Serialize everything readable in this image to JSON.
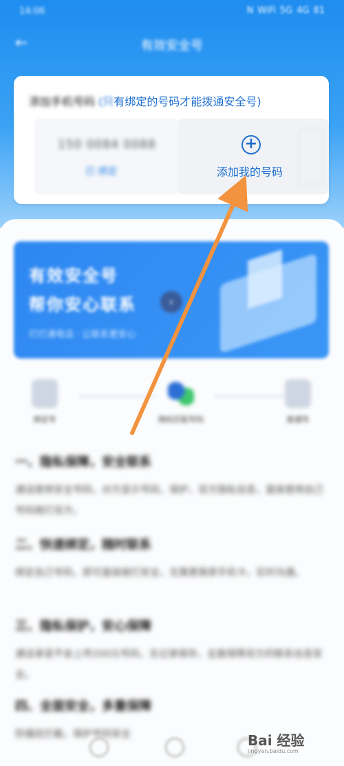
{
  "status_bar": {
    "time": "14:06",
    "icons": [
      "N",
      "WiFi",
      "5G",
      "4G",
      "81"
    ]
  },
  "titlebar": {
    "back_icon": "←",
    "title": "有效安全号"
  },
  "bind_card": {
    "hint_blurred": "添加手机号码",
    "hint_blue_partial": "(只",
    "hint_blue_clear": "有绑定的号码才能拨通安全号)",
    "existing_number": "150 0084 0088",
    "existing_sub": "已 绑定",
    "add_button_icon": "+",
    "add_button_label": "添加我的号码"
  },
  "banner": {
    "line1": "有效安全号",
    "line2": "帮你安心联系",
    "line3": "打打通电话 · 让联系更安心",
    "arrow": "›"
  },
  "steps": [
    {
      "label": "绑定号"
    },
    {
      "label": "随机匹配号码"
    },
    {
      "label": "拨通号"
    }
  ],
  "sections": [
    {
      "heading": "一、隐私保障，安全联系",
      "body": "通话使用安全号码，对方显示号码，保护，双方隐私信息，直接使用自己号码拨打双方。"
    },
    {
      "heading": "二、快速绑定，随时联系",
      "body": "绑定自己号码，即可直接拨打安全，无需更换原手机卡，实时沟通。"
    },
    {
      "heading": "三、隐私保护，安心保障",
      "body": "通话录音不会上传200元号码，无记录保存，全面保障双方的联系信息安全。"
    },
    {
      "heading": "四、全面安全，多重保障",
      "body": "防骚扰拦截，保护号码安全"
    }
  ],
  "watermark": {
    "brand": "Bai 经验",
    "url": "jingyan.baidu.com"
  },
  "colors": {
    "primary_blue": "#1d6fd0",
    "header_blue": "#2a95f2",
    "arrow_orange": "#f2933f"
  }
}
